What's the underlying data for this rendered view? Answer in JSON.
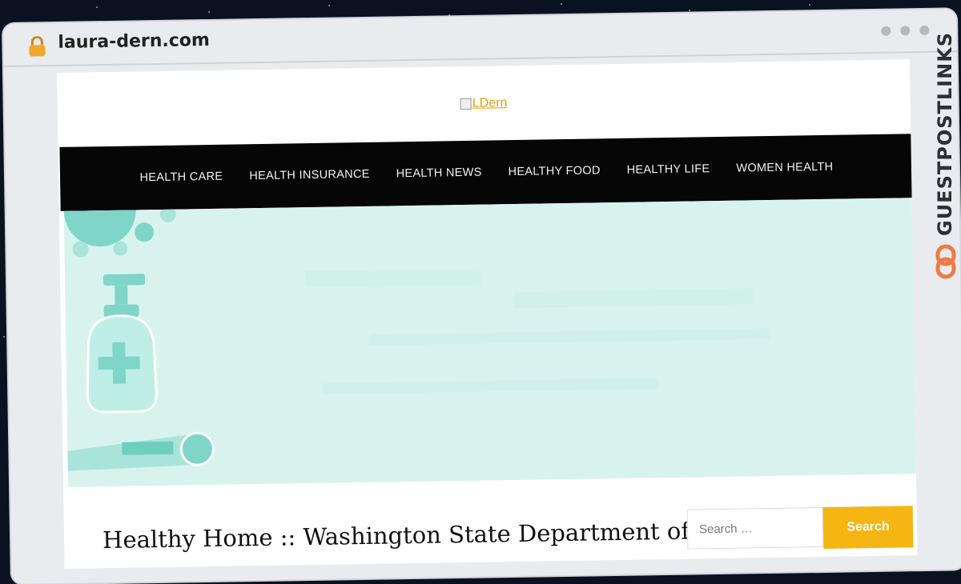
{
  "browser": {
    "url": "laura-dern.com"
  },
  "site": {
    "logo_alt": "LDern",
    "nav": [
      {
        "label": "HEALTH CARE"
      },
      {
        "label": "HEALTH INSURANCE"
      },
      {
        "label": "HEALTH NEWS"
      },
      {
        "label": "HEALTHY FOOD"
      },
      {
        "label": "HEALTHY LIFE"
      },
      {
        "label": "WOMEN HEALTH"
      }
    ]
  },
  "post": {
    "title": "Healthy Home :: Washington State Department of"
  },
  "search": {
    "placeholder": "Search …",
    "button_label": "Search"
  },
  "watermark": {
    "text": "GUESTPOSTLINKS"
  },
  "colors": {
    "accent": "#f5b614",
    "nav_bg": "#060606",
    "hero_bg": "#d8f3ee",
    "hero_teal": "#7fd6c8",
    "lock": "#f4a62a",
    "watermark_icon": "#f07a45"
  }
}
